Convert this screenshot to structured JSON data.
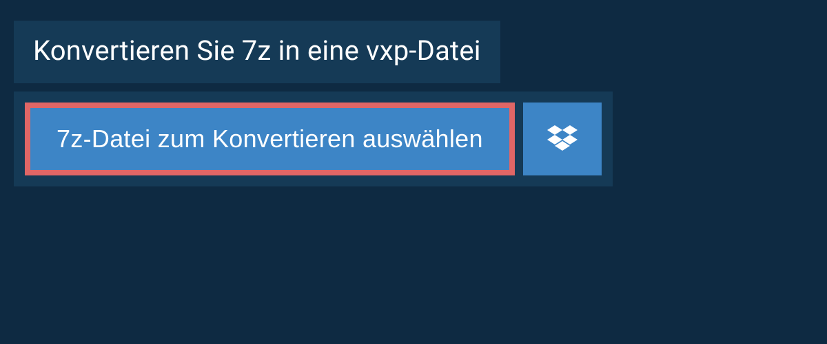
{
  "header": {
    "title": "Konvertieren Sie 7z in eine vxp-Datei"
  },
  "upload": {
    "select_label": "7z-Datei zum Konvertieren auswählen"
  },
  "colors": {
    "background": "#0e2a42",
    "panel": "#153a56",
    "button": "#3d85c6",
    "highlight_border": "#e06666"
  }
}
